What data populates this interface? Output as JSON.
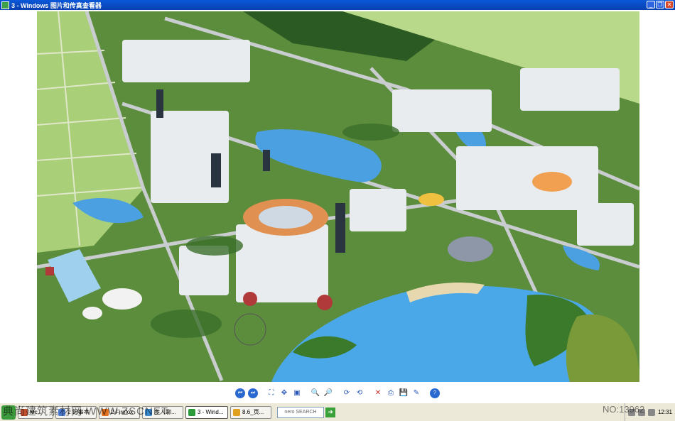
{
  "window": {
    "title": "3 - Windows 图片和传真查看器",
    "buttons": {
      "minimize": "_",
      "maximize": "❐",
      "close": "✕"
    }
  },
  "toolbar": {
    "items": [
      {
        "icon": "previous-image-icon",
        "glyph": "⏮"
      },
      {
        "icon": "next-image-icon",
        "glyph": "⏭"
      },
      {
        "icon": "best-fit-icon",
        "glyph": "⛶"
      },
      {
        "icon": "actual-size-icon",
        "glyph": "✥"
      },
      {
        "icon": "slideshow-icon",
        "glyph": "▣"
      },
      {
        "icon": "zoom-in-icon",
        "glyph": "🔍"
      },
      {
        "icon": "zoom-out-icon",
        "glyph": "🔎"
      },
      {
        "icon": "rotate-clockwise-icon",
        "glyph": "⟳"
      },
      {
        "icon": "rotate-counterclockwise-icon",
        "glyph": "⟲"
      },
      {
        "icon": "delete-icon",
        "glyph": "✕"
      },
      {
        "icon": "print-icon",
        "glyph": "⎙"
      },
      {
        "icon": "save-icon",
        "glyph": "💾"
      },
      {
        "icon": "edit-icon",
        "glyph": "✎"
      },
      {
        "icon": "help-icon",
        "glyph": "?"
      }
    ]
  },
  "taskbar": {
    "tasks": [
      {
        "label": "Mc",
        "icon_color": "#c05030",
        "active": false
      },
      {
        "label": "2 记事本",
        "icon_color": "#4a7ad0",
        "active": false
      },
      {
        "label": "2 Firefox",
        "icon_color": "#e07020",
        "active": false
      },
      {
        "label": "多人聊...",
        "icon_color": "#3a8ad0",
        "active": false
      },
      {
        "label": "3 - Wind...",
        "icon_color": "#2a9a3a",
        "active": true
      },
      {
        "label": "8.6_页...",
        "icon_color": "#e0a020",
        "active": false
      }
    ],
    "search_label": "nero SEARCH",
    "clock": "12:31"
  },
  "watermark": {
    "left": "典尚建筑素材网 WWW.ZSCNET",
    "right": "NO:13962"
  }
}
